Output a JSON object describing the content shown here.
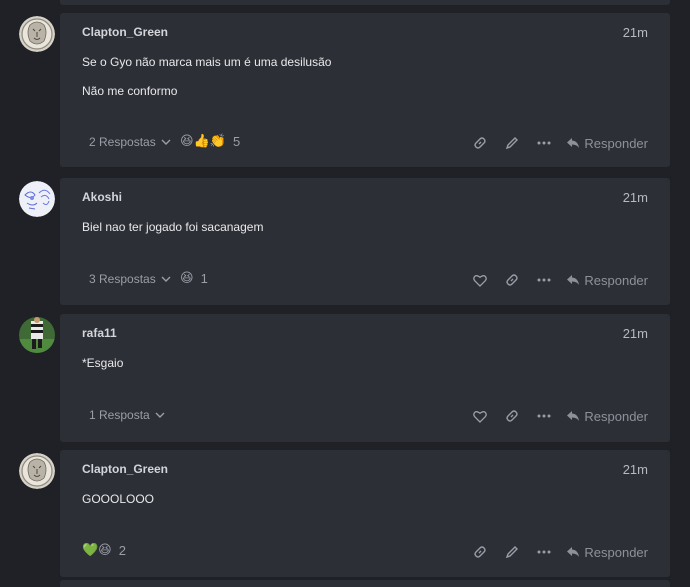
{
  "posts": [
    {
      "username": "Clapton_Green",
      "time": "21m",
      "lines": [
        "Se o Gyo não marca mais um é uma desilusão",
        "Não me conformo"
      ],
      "replies": "2 Respostas",
      "reactions": "😆👍👏",
      "reaction_count": "5",
      "avatar_icon": "lion-avatar-icon",
      "actions": [
        "link-icon",
        "pencil-icon",
        "more-icon"
      ],
      "reply_label": "Responder"
    },
    {
      "username": "Akoshi",
      "time": "21m",
      "lines": [
        "Biel nao ter jogado foi sacanagem"
      ],
      "replies": "3 Respostas",
      "reactions": "😆",
      "reaction_count": "1",
      "avatar_icon": "sketch-avatar-icon",
      "actions": [
        "heart-icon",
        "link-icon",
        "more-icon"
      ],
      "reply_label": "Responder"
    },
    {
      "username": "rafa11",
      "time": "21m",
      "lines": [
        "*Esgaio"
      ],
      "replies": "1 Resposta",
      "reactions": "",
      "reaction_count": "",
      "avatar_icon": "football-avatar-icon",
      "actions": [
        "heart-icon",
        "link-icon",
        "more-icon"
      ],
      "reply_label": "Responder"
    },
    {
      "username": "Clapton_Green",
      "time": "21m",
      "lines": [
        "GOOOLOOO"
      ],
      "replies": "",
      "reactions": "💚😆",
      "reaction_count": "2",
      "avatar_icon": "lion-avatar-icon",
      "actions": [
        "link-icon",
        "pencil-icon",
        "more-icon"
      ],
      "reply_label": "Responder"
    }
  ],
  "colors": {
    "background": "#1f2126",
    "card": "#2d2f36",
    "text": "#e8e9ec",
    "muted": "#9a9ea7"
  }
}
